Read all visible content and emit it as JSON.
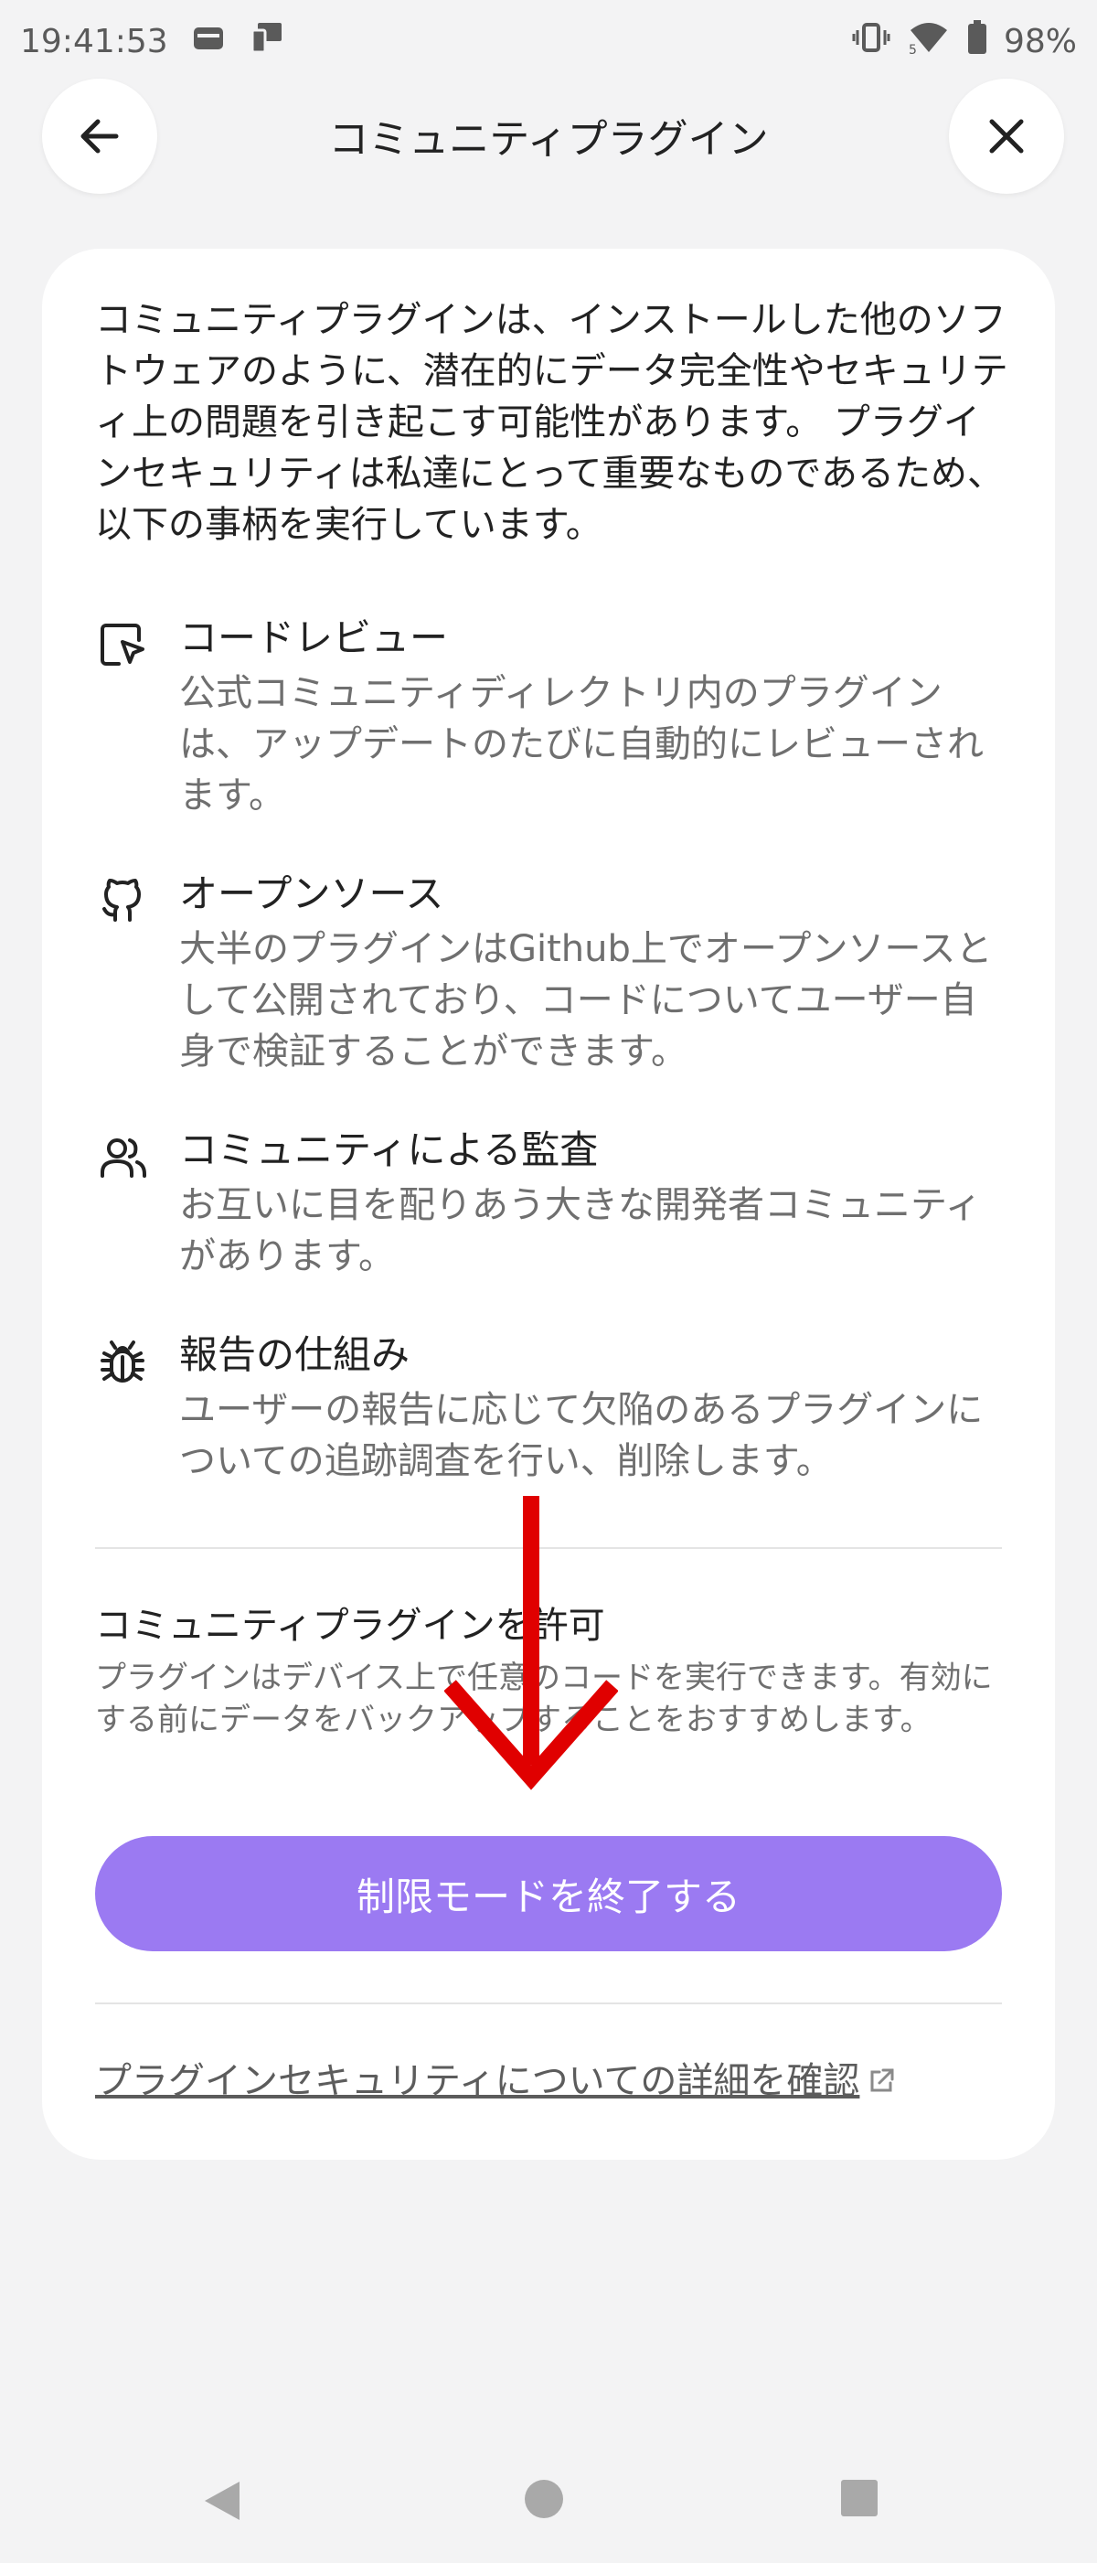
{
  "status_bar": {
    "time": "19:41:53",
    "battery": "98%",
    "icons": [
      "sim-card-icon",
      "cast-icon",
      "vibrate-icon",
      "wifi-icon",
      "battery-icon"
    ]
  },
  "header": {
    "title": "コミュニティプラグイン",
    "back_icon": "arrow-left-icon",
    "close_icon": "close-icon"
  },
  "intro_text": "コミュニティプラグインは、インストールした他のソフトウェアのように、潜在的にデータ完全性やセキュリティ上の問題を引き起こす可能性があります。 プラグインセキュリティは私達にとって重要なものであるため、以下の事柄を実行しています。",
  "features": [
    {
      "icon": "code-review-icon",
      "title": "コードレビュー",
      "desc": "公式コミュニティディレクトリ内のプラグインは、アップデートのたびに自動的にレビューされます。"
    },
    {
      "icon": "github-icon",
      "title": "オープンソース",
      "desc": "大半のプラグインはGithub上でオープンソースとして公開されており、コードについてユーザー自身で検証することができます。"
    },
    {
      "icon": "users-icon",
      "title": "コミュニティによる監査",
      "desc": "お互いに目を配りあう大きな開発者コミュニティがあります。"
    },
    {
      "icon": "bug-icon",
      "title": "報告の仕組み",
      "desc": "ユーザーの報告に応じて欠陥のあるプラグインについての追跡調査を行い、削除します。"
    }
  ],
  "allow": {
    "title": "コミュニティプラグインを許可",
    "desc": "プラグインはデバイス上で任意のコードを実行できます。有効にする前にデータをバックアップすることをおすすめします。",
    "button_label": "制限モードを終了する"
  },
  "learn_more": {
    "label": "プラグインセキュリティについての詳細を確認",
    "icon": "external-link-icon"
  },
  "colors": {
    "accent": "#9b7af2",
    "annotation": "#e00000",
    "background": "#f3f3f4",
    "card": "#ffffff"
  },
  "nav_bar": {
    "icons": [
      "back-triangle-icon",
      "home-circle-icon",
      "recents-square-icon"
    ]
  }
}
